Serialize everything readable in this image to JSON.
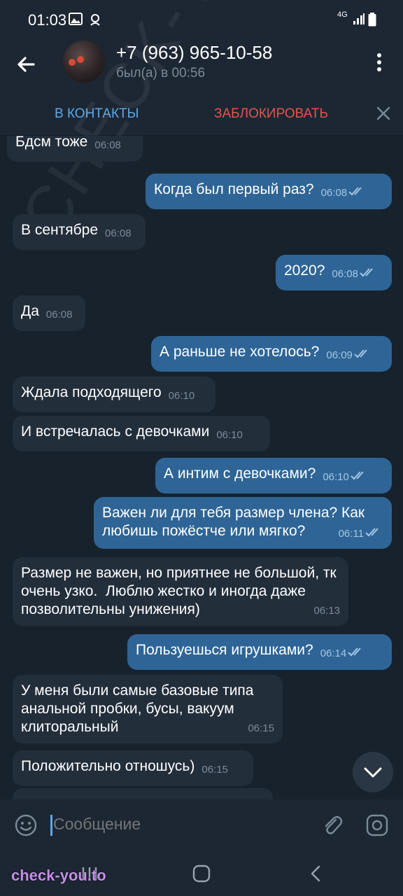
{
  "status_bar": {
    "time": "01:03",
    "network": "4G"
  },
  "header": {
    "title": "+7 (963) 965-10-58",
    "subtitle": "был(а) в 00:56"
  },
  "action_bar": {
    "add_contact": "В КОНТАКТЫ",
    "block": "ЗАБЛОКИРОВАТЬ"
  },
  "messages": [
    {
      "dir": "in",
      "text": "Бдсм тоже",
      "time": "06:08"
    },
    {
      "dir": "out",
      "text": "Когда был первый раз?",
      "time": "06:08"
    },
    {
      "dir": "in",
      "text": "В сентябре",
      "time": "06:08"
    },
    {
      "dir": "out",
      "text": "2020?",
      "time": "06:08"
    },
    {
      "dir": "in",
      "text": "Да",
      "time": "06:08"
    },
    {
      "dir": "out",
      "text": "А раньше не хотелось?",
      "time": "06:09"
    },
    {
      "dir": "in",
      "text": "Ждала подходящего",
      "time": "06:10"
    },
    {
      "dir": "in",
      "text": "И встречалась с девочками",
      "time": "06:10"
    },
    {
      "dir": "out",
      "text": "А интим с девочками?",
      "time": "06:10"
    },
    {
      "dir": "out",
      "text": "Важен ли для тебя размер члена? Как любишь пожёстче или мягко?",
      "time": "06:11"
    },
    {
      "dir": "in",
      "text": "Размер не важен, но приятнее не большой, тк очень узко.  Люблю жестко и иногда даже позволительны унижения)",
      "time": "06:13"
    },
    {
      "dir": "out",
      "text": "Пользуешься игрушками?",
      "time": "06:14"
    },
    {
      "dir": "in",
      "text": "У меня были самые базовые типа анальной пробки, бусы, вакуум клиторальный",
      "time": "06:15"
    },
    {
      "dir": "in",
      "text": "Положительно отношусь)",
      "time": "06:15"
    }
  ],
  "input": {
    "placeholder": "Сообщение"
  },
  "watermarks": {
    "corner": "check-you.to",
    "diagonal": "CHECK-YOU.ME"
  },
  "colors": {
    "incoming": "#232e3b",
    "outgoing": "#2e6596",
    "accent": "#5ea8e6",
    "danger": "#e0564f"
  }
}
